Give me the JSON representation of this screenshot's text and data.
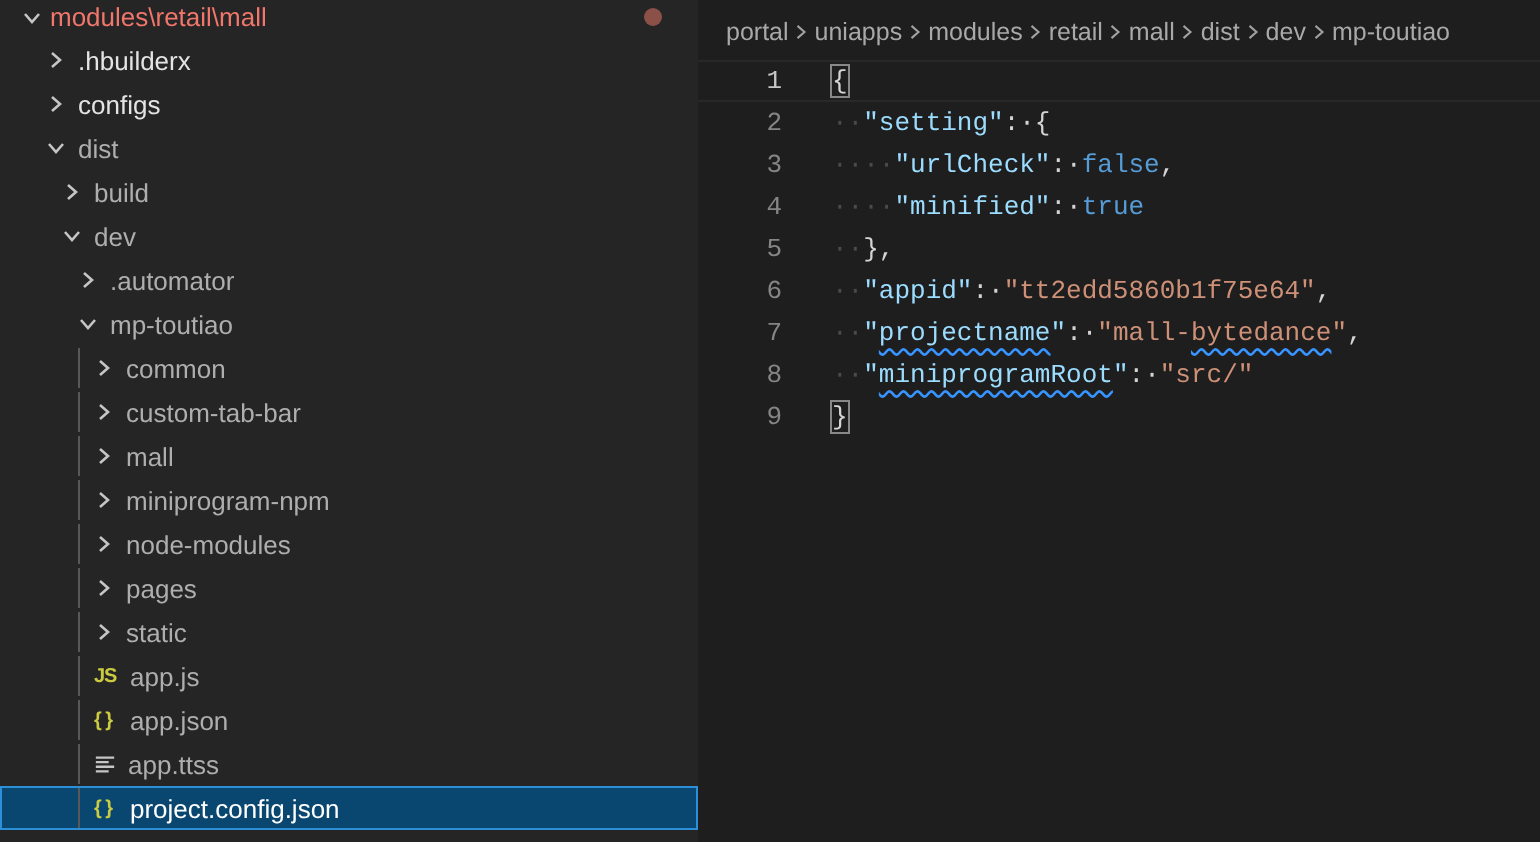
{
  "explorer": {
    "root": {
      "label": "modules\\retail\\mall",
      "expanded": true,
      "modified": true,
      "children": [
        {
          "label": ".hbuilderx",
          "kind": "folder",
          "expanded": false,
          "selected": false
        },
        {
          "label": "configs",
          "kind": "folder",
          "expanded": false,
          "selected": false
        },
        {
          "label": "dist",
          "kind": "folder",
          "expanded": true,
          "selected": false,
          "children": [
            {
              "label": "build",
              "kind": "folder",
              "expanded": false,
              "selected": false
            },
            {
              "label": "dev",
              "kind": "folder",
              "expanded": true,
              "selected": false,
              "children": [
                {
                  "label": ".automator",
                  "kind": "folder",
                  "expanded": false,
                  "selected": false
                },
                {
                  "label": "mp-toutiao",
                  "kind": "folder",
                  "expanded": true,
                  "selected": false,
                  "children": [
                    {
                      "label": "common",
                      "kind": "folder",
                      "expanded": false,
                      "selected": false
                    },
                    {
                      "label": "custom-tab-bar",
                      "kind": "folder",
                      "expanded": false,
                      "selected": false
                    },
                    {
                      "label": "mall",
                      "kind": "folder",
                      "expanded": false,
                      "selected": false
                    },
                    {
                      "label": "miniprogram-npm",
                      "kind": "folder",
                      "expanded": false,
                      "selected": false
                    },
                    {
                      "label": "node-modules",
                      "kind": "folder",
                      "expanded": false,
                      "selected": false
                    },
                    {
                      "label": "pages",
                      "kind": "folder",
                      "expanded": false,
                      "selected": false
                    },
                    {
                      "label": "static",
                      "kind": "folder",
                      "expanded": false,
                      "selected": false
                    },
                    {
                      "label": "app.js",
                      "kind": "js",
                      "icon_text": "JS",
                      "selected": false
                    },
                    {
                      "label": "app.json",
                      "kind": "json",
                      "icon_text": "{ }",
                      "selected": false
                    },
                    {
                      "label": "app.ttss",
                      "kind": "lines",
                      "selected": false
                    },
                    {
                      "label": "project.config.json",
                      "kind": "json",
                      "icon_text": "{ }",
                      "selected": true
                    }
                  ]
                }
              ]
            }
          ]
        }
      ]
    }
  },
  "breadcrumbs": [
    "portal",
    "uniapps",
    "modules",
    "retail",
    "mall",
    "dist",
    "dev",
    "mp-toutiao"
  ],
  "editor": {
    "lines": [
      {
        "number": "1",
        "current": true,
        "tokens": [
          {
            "kind": "bracket",
            "text": "{"
          }
        ]
      },
      {
        "number": "2",
        "current": false,
        "tokens": [
          {
            "kind": "indent",
            "text": "··"
          },
          {
            "kind": "key",
            "text": "\"setting\""
          },
          {
            "kind": "punct",
            "text": ":·{"
          }
        ]
      },
      {
        "number": "3",
        "current": false,
        "tokens": [
          {
            "kind": "indent",
            "text": "····"
          },
          {
            "kind": "key",
            "text": "\"urlCheck\""
          },
          {
            "kind": "punct",
            "text": ":·"
          },
          {
            "kind": "keyword",
            "text": "false"
          },
          {
            "kind": "punct",
            "text": ","
          }
        ]
      },
      {
        "number": "4",
        "current": false,
        "tokens": [
          {
            "kind": "indent",
            "text": "····"
          },
          {
            "kind": "key",
            "text": "\"minified\""
          },
          {
            "kind": "punct",
            "text": ":·"
          },
          {
            "kind": "keyword",
            "text": "true"
          }
        ]
      },
      {
        "number": "5",
        "current": false,
        "tokens": [
          {
            "kind": "indent",
            "text": "··"
          },
          {
            "kind": "punct",
            "text": "},"
          }
        ]
      },
      {
        "number": "6",
        "current": false,
        "tokens": [
          {
            "kind": "indent",
            "text": "··"
          },
          {
            "kind": "key",
            "text": "\"appid\""
          },
          {
            "kind": "punct",
            "text": ":·"
          },
          {
            "kind": "string",
            "text": "\"tt2edd5860b1f75e64\""
          },
          {
            "kind": "punct",
            "text": ","
          }
        ]
      },
      {
        "number": "7",
        "current": false,
        "tokens": [
          {
            "kind": "indent",
            "text": "··"
          },
          {
            "kind": "key",
            "text": "\""
          },
          {
            "kind": "key",
            "text": "projectname",
            "squiggle": true
          },
          {
            "kind": "key",
            "text": "\""
          },
          {
            "kind": "punct",
            "text": ":·"
          },
          {
            "kind": "string",
            "text": "\"mall-"
          },
          {
            "kind": "string",
            "text": "bytedance",
            "squiggle": true
          },
          {
            "kind": "string",
            "text": "\""
          },
          {
            "kind": "punct",
            "text": ","
          }
        ]
      },
      {
        "number": "8",
        "current": false,
        "tokens": [
          {
            "kind": "indent",
            "text": "··"
          },
          {
            "kind": "key",
            "text": "\""
          },
          {
            "kind": "key",
            "text": "miniprogramRoot",
            "squiggle": true
          },
          {
            "kind": "key",
            "text": "\""
          },
          {
            "kind": "punct",
            "text": ":·"
          },
          {
            "kind": "string",
            "text": "\"src/\""
          }
        ]
      },
      {
        "number": "9",
        "current": false,
        "tokens": [
          {
            "kind": "bracket",
            "text": "}"
          }
        ]
      }
    ]
  }
}
